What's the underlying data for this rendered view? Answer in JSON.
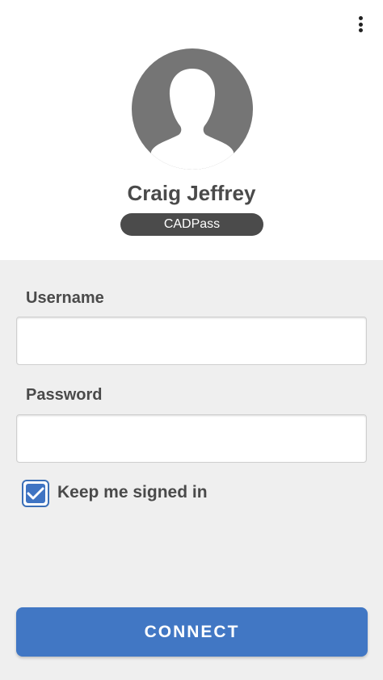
{
  "profile": {
    "name": "Craig Jeffrey",
    "badge": "CADPass"
  },
  "form": {
    "username_label": "Username",
    "username_value": "",
    "password_label": "Password",
    "password_value": "",
    "keep_signed_in_label": "Keep me signed in",
    "keep_signed_in_checked": true,
    "connect_label": "CONNECT"
  },
  "icons": {
    "menu": "more-vertical-icon",
    "avatar": "user-silhouette-icon",
    "check": "checkmark-icon"
  },
  "colors": {
    "accent": "#4177c4",
    "badge_bg": "#4b4b4b",
    "avatar_bg": "#757575",
    "form_bg": "#efefef"
  }
}
